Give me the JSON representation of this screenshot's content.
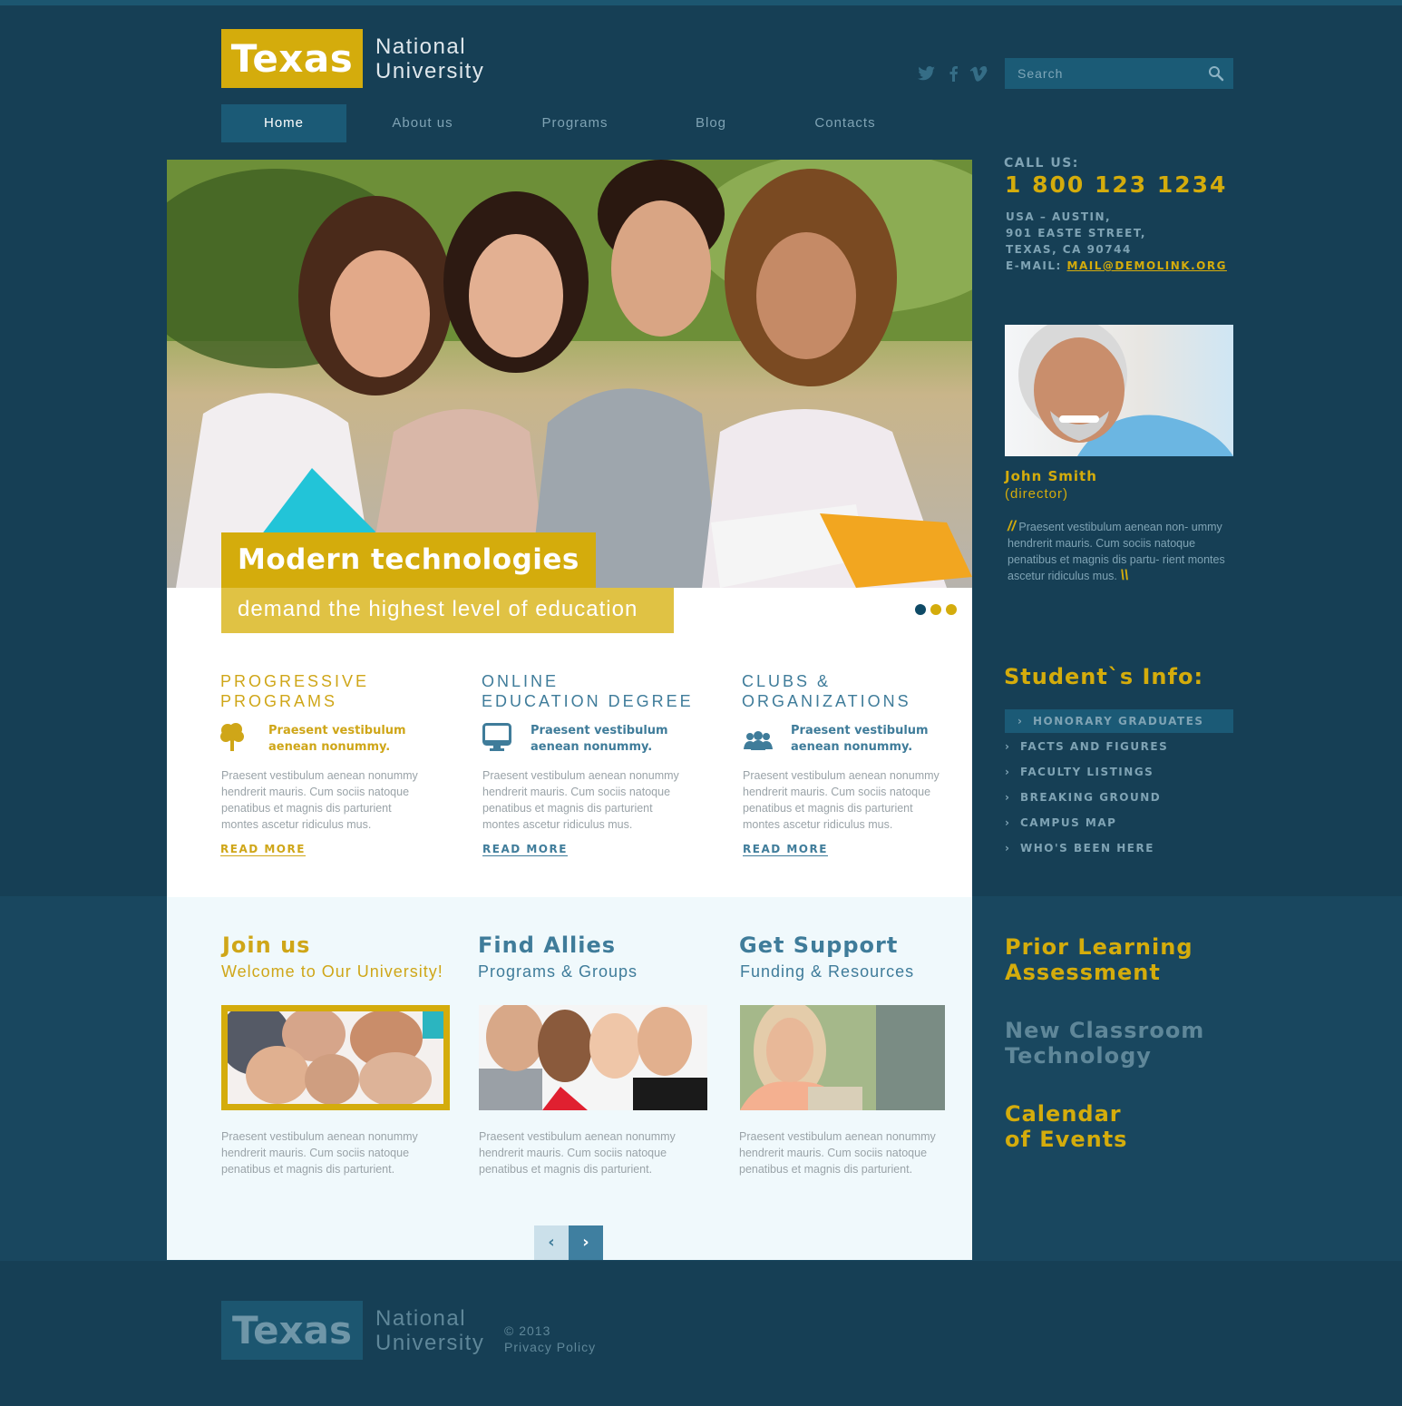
{
  "brand": {
    "name": "Texas",
    "subtitle_line1": "National",
    "subtitle_line2": "University"
  },
  "social": [
    {
      "icon": "twitter-icon",
      "glyph": "🐦︎"
    },
    {
      "icon": "facebook-icon",
      "glyph": "f"
    },
    {
      "icon": "vimeo-icon",
      "glyph": "V"
    }
  ],
  "search": {
    "placeholder": "Search",
    "value": ""
  },
  "nav": {
    "items": [
      {
        "label": "Home",
        "active": true
      },
      {
        "label": "About us"
      },
      {
        "label": "Programs"
      },
      {
        "label": "Blog"
      },
      {
        "label": "Contacts"
      }
    ]
  },
  "hero": {
    "caption_title": "Modern technologies",
    "caption_sub": "demand the highest level of education",
    "slides": 3,
    "active_slide": 1,
    "colors": {
      "active": "#0e4a66",
      "inactive": "#d4ac0c"
    }
  },
  "contact": {
    "call_label": "CALL US:",
    "phone": "1 800 123 1234",
    "address_lines": [
      "USA – AUSTIN,",
      "901 EASTE STREET,",
      "TEXAS, CA 90744"
    ],
    "email_label": "E-MAIL:",
    "email": "MAIL@DEMOLINK.ORG"
  },
  "director": {
    "name": "John Smith",
    "role": "(director)",
    "quote": "Praesent vestibulum aenean non- ummy hendrerit mauris. Cum sociis natoque penatibus et magnis dis partu- rient montes ascetur ridiculus mus."
  },
  "student_info": {
    "title": "Student`s Info:",
    "items": [
      {
        "label": "HONORARY GRADUATES",
        "active": true
      },
      {
        "label": "FACTS AND FIGURES"
      },
      {
        "label": "FACULTY LISTINGS"
      },
      {
        "label": "BREAKING GROUND"
      },
      {
        "label": "CAMPUS MAP"
      },
      {
        "label": "WHO'S BEEN HERE"
      }
    ]
  },
  "features": [
    {
      "title_line1": "PROGRESSIVE",
      "title_line2": "PROGRAMS",
      "icon": "tree-icon",
      "lead_line1": "Praesent vestibulum",
      "lead_line2": "aenean nonummy.",
      "text": "Praesent vestibulum aenean nonummy hendrerit mauris. Cum sociis natoque penatibus et magnis dis parturient montes ascetur ridiculus mus.",
      "link": "READ MORE"
    },
    {
      "title_line1": "ONLINE",
      "title_line2": "EDUCATION DEGREE",
      "icon": "monitor-icon",
      "lead_line1": "Praesent vestibulum",
      "lead_line2": "aenean nonummy.",
      "text": "Praesent vestibulum aenean nonummy hendrerit mauris. Cum sociis natoque penatibus et magnis dis parturient montes ascetur ridiculus mus.",
      "link": "READ MORE"
    },
    {
      "title_line1": "CLUBS &",
      "title_line2": "ORGANIZATIONS",
      "icon": "group-icon",
      "lead_line1": "Praesent vestibulum",
      "lead_line2": "aenean nonummy.",
      "text": "Praesent vestibulum aenean nonummy hendrerit mauris. Cum sociis natoque penatibus et magnis dis parturient montes ascetur ridiculus mus.",
      "link": "READ MORE"
    }
  ],
  "lower": [
    {
      "title": "Join us",
      "subtitle": "Welcome to Our University!",
      "text": "Praesent vestibulum aenean nonummy hendrerit mauris. Cum sociis natoque penatibus et magnis dis parturient."
    },
    {
      "title": "Find Allies",
      "subtitle": "Programs & Groups",
      "text": "Praesent vestibulum aenean nonummy hendrerit mauris. Cum sociis natoque penatibus et magnis dis parturient."
    },
    {
      "title": "Get Support",
      "subtitle": "Funding & Resources",
      "text": "Praesent vestibulum aenean nonummy hendrerit mauris. Cum sociis natoque penatibus et magnis dis parturient."
    }
  ],
  "pager": {
    "prev": "‹",
    "next": "›"
  },
  "side_links": [
    {
      "line1": "Prior Learning",
      "line2": "Assessment",
      "color": "#d4ac0c"
    },
    {
      "line1": "New Classroom",
      "line2": "Technology",
      "color": "#5f8799"
    },
    {
      "line1": "Calendar",
      "line2": "of Events",
      "color": "#d4ac0c"
    }
  ],
  "footer": {
    "brand": "Texas",
    "subtitle_line1": "National",
    "subtitle_line2": "University",
    "copyright": "© 2013",
    "privacy": "Privacy Policy"
  },
  "colors": {
    "gold": "#d4ac0c",
    "navy_bg": "#163f55",
    "accent_blue": "#1b5a76",
    "link_blue": "#3f7c9a"
  }
}
